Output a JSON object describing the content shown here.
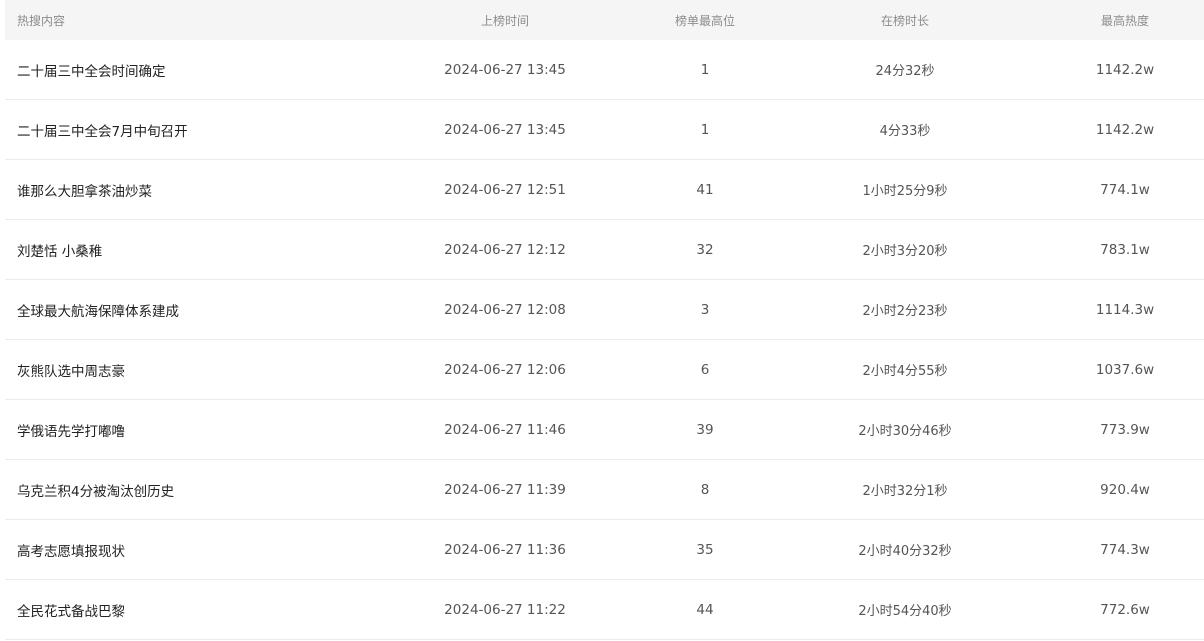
{
  "table": {
    "headers": {
      "title": "热搜内容",
      "time": "上榜时间",
      "rank": "榜单最高位",
      "duration": "在榜时长",
      "heat": "最高热度"
    },
    "rows": [
      {
        "title": "二十届三中全会时间确定",
        "time": "2024-06-27 13:45",
        "rank": "1",
        "duration": "24分32秒",
        "heat": "1142.2w"
      },
      {
        "title": "二十届三中全会7月中旬召开",
        "time": "2024-06-27 13:45",
        "rank": "1",
        "duration": "4分33秒",
        "heat": "1142.2w"
      },
      {
        "title": "谁那么大胆拿茶油炒菜",
        "time": "2024-06-27 12:51",
        "rank": "41",
        "duration": "1小时25分9秒",
        "heat": "774.1w"
      },
      {
        "title": "刘楚恬 小桑稚",
        "time": "2024-06-27 12:12",
        "rank": "32",
        "duration": "2小时3分20秒",
        "heat": "783.1w"
      },
      {
        "title": "全球最大航海保障体系建成",
        "time": "2024-06-27 12:08",
        "rank": "3",
        "duration": "2小时2分23秒",
        "heat": "1114.3w"
      },
      {
        "title": "灰熊队选中周志豪",
        "time": "2024-06-27 12:06",
        "rank": "6",
        "duration": "2小时4分55秒",
        "heat": "1037.6w"
      },
      {
        "title": "学俄语先学打嘟噜",
        "time": "2024-06-27 11:46",
        "rank": "39",
        "duration": "2小时30分46秒",
        "heat": "773.9w"
      },
      {
        "title": "乌克兰积4分被淘汰创历史",
        "time": "2024-06-27 11:39",
        "rank": "8",
        "duration": "2小时32分1秒",
        "heat": "920.4w"
      },
      {
        "title": "高考志愿填报现状",
        "time": "2024-06-27 11:36",
        "rank": "35",
        "duration": "2小时40分32秒",
        "heat": "774.3w"
      },
      {
        "title": "全民花式备战巴黎",
        "time": "2024-06-27 11:22",
        "rank": "44",
        "duration": "2小时54分40秒",
        "heat": "772.6w"
      }
    ]
  }
}
